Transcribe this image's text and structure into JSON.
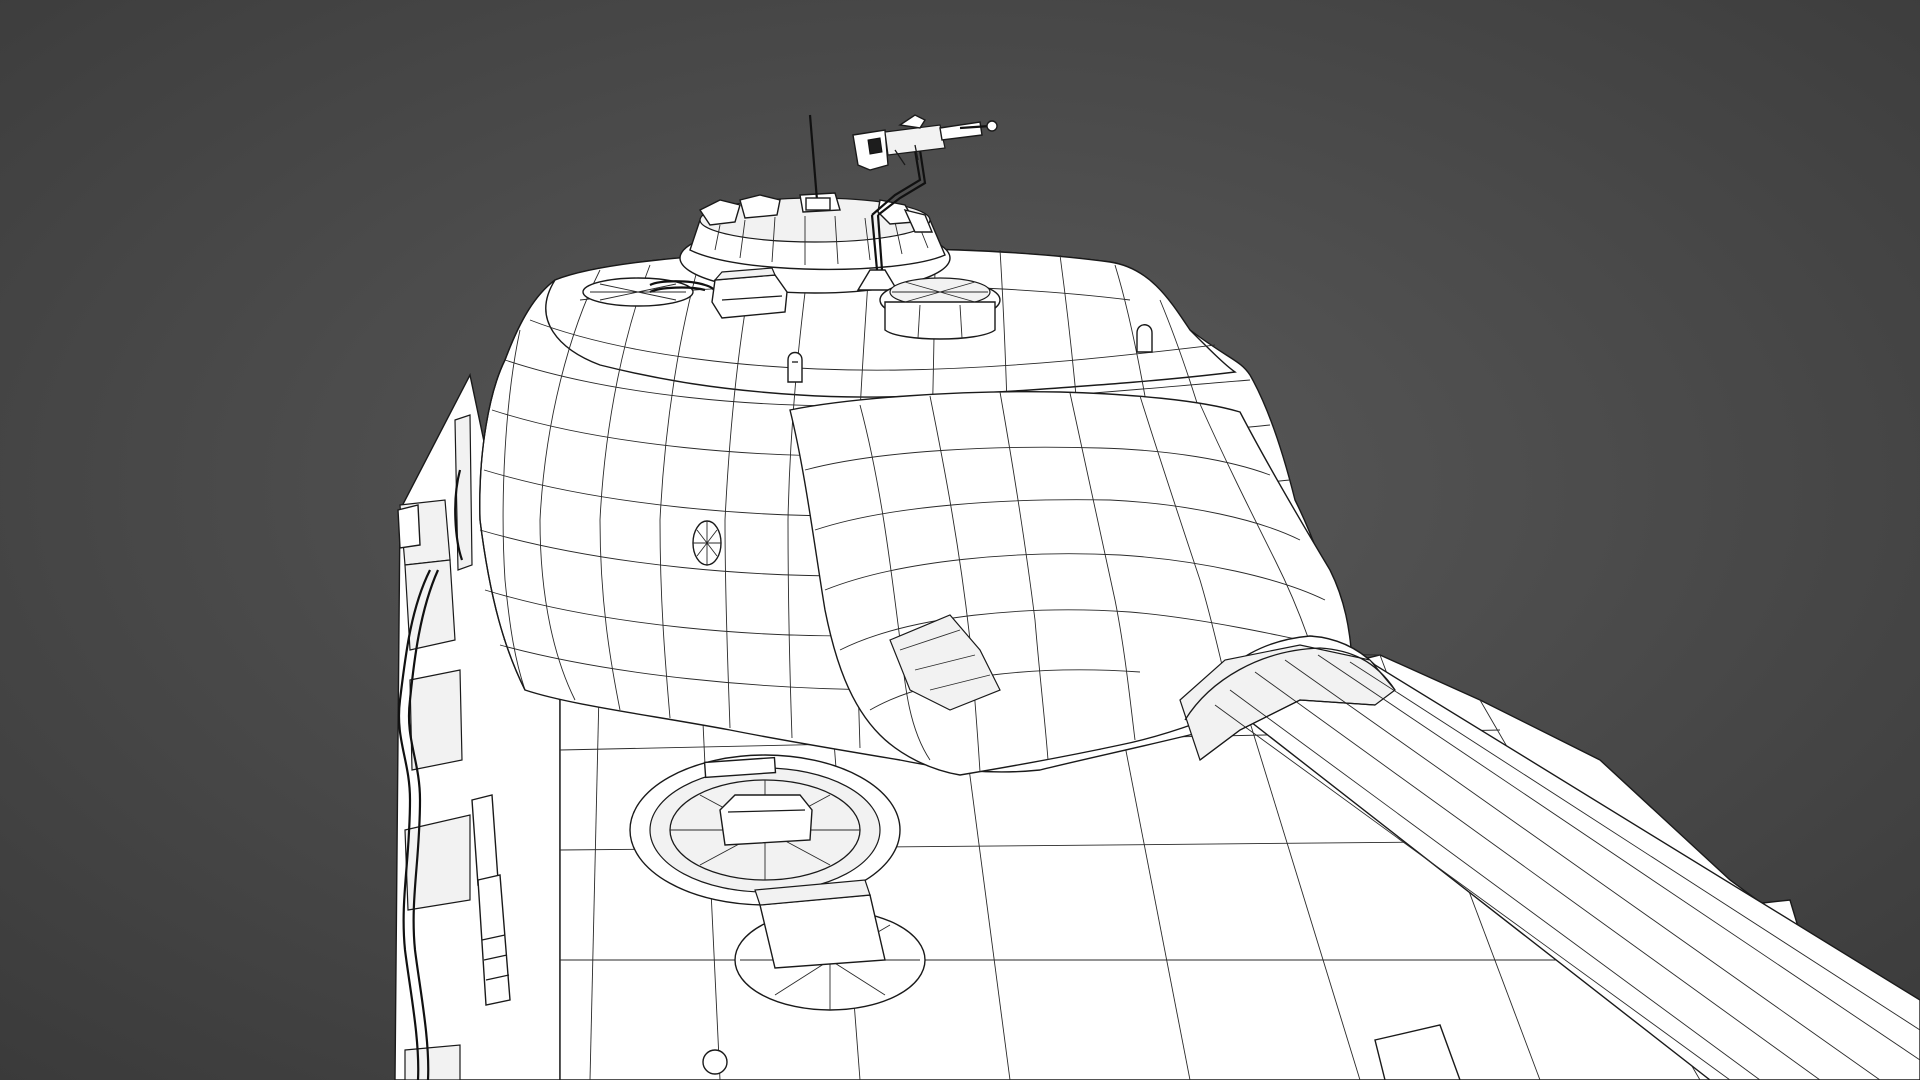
{
  "scene": {
    "subject": "tank-turret-wireframe",
    "background_color_center": "#5a5a5a",
    "background_color_edge": "#3a3a3a",
    "mesh_fill_color": "#ffffff",
    "wire_color": "#1a1a1a"
  }
}
